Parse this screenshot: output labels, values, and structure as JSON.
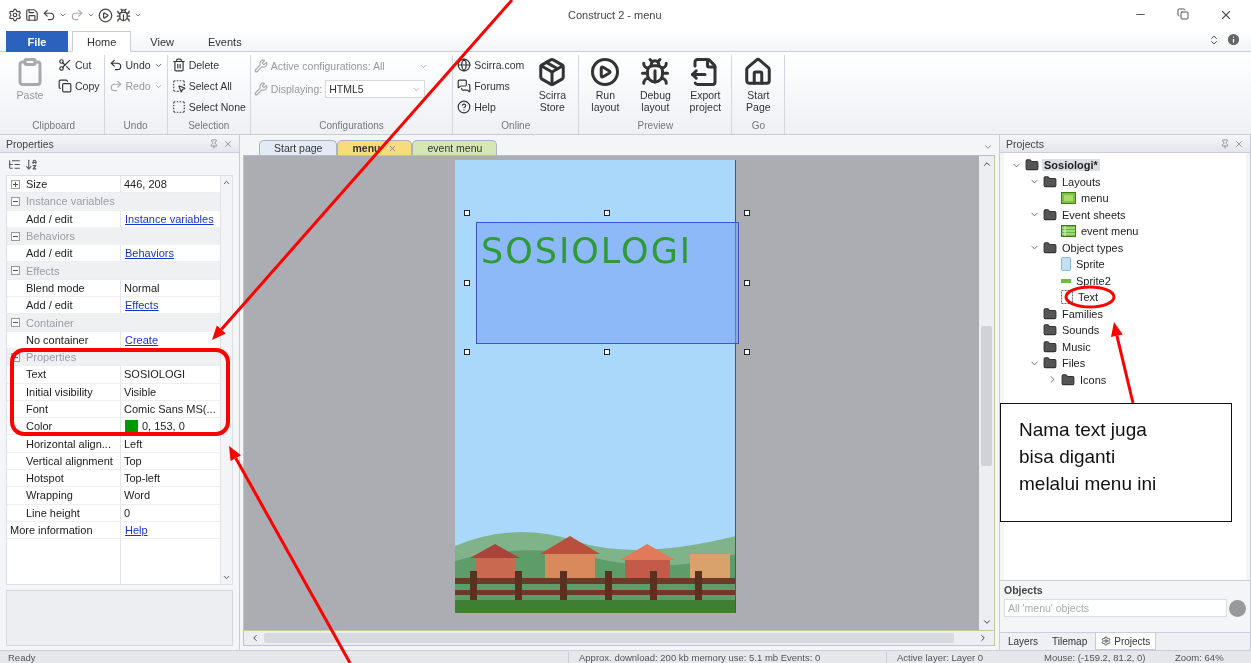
{
  "window": {
    "title": "Construct 2 - menu"
  },
  "ribbon": {
    "tabs": [
      {
        "label": "File",
        "kind": "file",
        "selected": false
      },
      {
        "label": "Home",
        "kind": "tab",
        "selected": true
      },
      {
        "label": "View",
        "kind": "tab",
        "selected": false
      },
      {
        "label": "Events",
        "kind": "tab",
        "selected": false
      }
    ],
    "groups": [
      {
        "label": "Clipboard",
        "items": [
          {
            "kind": "large",
            "label": "Paste",
            "disabled": true
          },
          {
            "kind": "small",
            "label": "Cut",
            "disabled": false
          },
          {
            "kind": "small",
            "label": "Copy",
            "disabled": false
          }
        ]
      },
      {
        "label": "Undo",
        "items": [
          {
            "kind": "split",
            "label": "Undo",
            "disabled": false
          },
          {
            "kind": "split",
            "label": "Redo",
            "disabled": true
          }
        ]
      },
      {
        "label": "Selection",
        "items": [
          {
            "kind": "small",
            "label": "Delete",
            "disabled": false
          },
          {
            "kind": "small",
            "label": "Select All",
            "disabled": false
          },
          {
            "kind": "small",
            "label": "Select None",
            "disabled": false
          }
        ]
      },
      {
        "label": "Configurations",
        "items": [
          {
            "kind": "config",
            "label": "Active configurations: All",
            "disabled": true
          },
          {
            "kind": "config",
            "label": "Displaying:",
            "value": "HTML5",
            "disabled": true
          }
        ]
      },
      {
        "label": "Online",
        "items": [
          {
            "kind": "small",
            "label": "Scirra.com",
            "disabled": false
          },
          {
            "kind": "small",
            "label": "Forums",
            "disabled": false
          },
          {
            "kind": "small",
            "label": "Help",
            "disabled": false
          },
          {
            "kind": "large",
            "label": "Scirra Store",
            "disabled": false
          }
        ]
      },
      {
        "label": "Preview",
        "items": [
          {
            "kind": "large",
            "label": "Run layout",
            "disabled": false
          },
          {
            "kind": "large",
            "label": "Debug layout",
            "disabled": false
          },
          {
            "kind": "large",
            "label": "Export project",
            "disabled": false
          }
        ]
      },
      {
        "label": "Go",
        "items": [
          {
            "kind": "large",
            "label": "Start Page",
            "disabled": false
          }
        ]
      }
    ]
  },
  "properties": {
    "title": "Properties",
    "rows": [
      {
        "kind": "expandable",
        "name": "Size",
        "value": "446, 208",
        "expanded": false
      },
      {
        "kind": "group",
        "name": "Instance variables",
        "expanded": true
      },
      {
        "kind": "link",
        "name": "Add / edit",
        "value": "Instance variables"
      },
      {
        "kind": "group",
        "name": "Behaviors",
        "expanded": true
      },
      {
        "kind": "link",
        "name": "Add / edit",
        "value": "Behaviors"
      },
      {
        "kind": "group",
        "name": "Effects",
        "expanded": true
      },
      {
        "kind": "field",
        "name": "Blend mode",
        "value": "Normal"
      },
      {
        "kind": "link",
        "name": "Add / edit",
        "value": "Effects"
      },
      {
        "kind": "group",
        "name": "Container",
        "expanded": true
      },
      {
        "kind": "link",
        "name": "No container",
        "value": "Create"
      },
      {
        "kind": "group",
        "name": "Properties",
        "expanded": true
      },
      {
        "kind": "field",
        "name": "Text",
        "value": "SOSIOLOGI"
      },
      {
        "kind": "field",
        "name": "Initial visibility",
        "value": "Visible"
      },
      {
        "kind": "field",
        "name": "Font",
        "value": "Comic Sans MS(..."
      },
      {
        "kind": "color",
        "name": "Color",
        "value": "0, 153, 0",
        "color": "#009900"
      },
      {
        "kind": "field",
        "name": "Horizontal align...",
        "value": "Left"
      },
      {
        "kind": "field",
        "name": "Vertical alignment",
        "value": "Top"
      },
      {
        "kind": "field",
        "name": "Hotspot",
        "value": "Top-left"
      },
      {
        "kind": "field",
        "name": "Wrapping",
        "value": "Word"
      },
      {
        "kind": "field",
        "name": "Line height",
        "value": "0"
      },
      {
        "kind": "info",
        "name": "More information",
        "value": "Help"
      }
    ]
  },
  "documents": {
    "tabs": [
      {
        "label": "Start page",
        "color": "#e2eaf6",
        "selected": false
      },
      {
        "label": "menu",
        "color": "#f6dc7c",
        "selected": true
      },
      {
        "label": "event menu",
        "color": "#d6e6b4",
        "selected": false
      }
    ]
  },
  "layout": {
    "text_object": "SOSIOLOGI"
  },
  "projects": {
    "title": "Projects",
    "tree": [
      {
        "label": "Sosiologi*",
        "kind": "project",
        "expanded": true,
        "selected": true,
        "children": [
          {
            "label": "Layouts",
            "kind": "folder",
            "expanded": true,
            "selected": false,
            "children": [
              {
                "label": "menu",
                "kind": "layout",
                "selected": false
              }
            ]
          },
          {
            "label": "Event sheets",
            "kind": "folder",
            "expanded": true,
            "selected": false,
            "children": [
              {
                "label": "event menu",
                "kind": "event-sheet",
                "selected": false
              }
            ]
          },
          {
            "label": "Object types",
            "kind": "folder",
            "expanded": true,
            "selected": false,
            "children": [
              {
                "label": "Sprite",
                "kind": "sprite",
                "selected": false
              },
              {
                "label": "Sprite2",
                "kind": "bar",
                "selected": false
              },
              {
                "label": "Text",
                "kind": "text",
                "selected": false
              }
            ]
          },
          {
            "label": "Families",
            "kind": "folder",
            "selected": false
          },
          {
            "label": "Sounds",
            "kind": "folder",
            "selected": false
          },
          {
            "label": "Music",
            "kind": "folder",
            "selected": false
          },
          {
            "label": "Files",
            "kind": "folder",
            "expanded": true,
            "selected": false,
            "children": [
              {
                "label": "Icons",
                "kind": "folder",
                "expanded": false,
                "selected": false
              }
            ]
          }
        ]
      }
    ]
  },
  "objects": {
    "title": "Objects",
    "placeholder": "All 'menu' objects"
  },
  "bottom_tabs": [
    {
      "label": "Layers",
      "selected": false
    },
    {
      "label": "Tilemap",
      "selected": false
    },
    {
      "label": "Projects",
      "selected": true
    }
  ],
  "status_bar": {
    "left": "Ready",
    "download": "Approx. download: 200 kb  memory use: 5.1 mb  Events: 0",
    "layer": "Active layer: Layer 0",
    "mouse": "Mouse: (-159.2, 81.2, 0)",
    "zoom": "Zoom: 64%"
  },
  "annotation": {
    "callout": "Nama text juga\nbisa diganti\nmelalui menu ini"
  }
}
